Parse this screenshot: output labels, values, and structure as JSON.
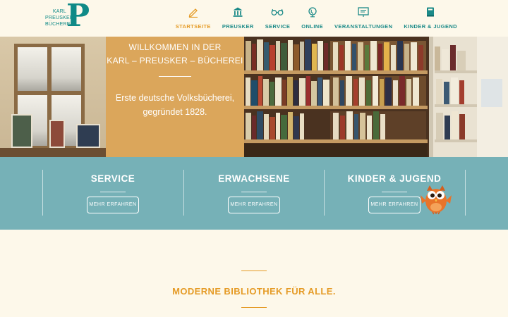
{
  "logo": {
    "line1": "KARL",
    "line2": "PREUSKER",
    "line3": "BÜCHEREI",
    "letter": "P"
  },
  "nav": {
    "items": [
      {
        "label": "STARTSEITE",
        "icon": "pencil-icon"
      },
      {
        "label": "PREUSKER",
        "icon": "building-icon"
      },
      {
        "label": "SERVICE",
        "icon": "glasses-icon"
      },
      {
        "label": "ONLINE",
        "icon": "globe-icon"
      },
      {
        "label": "VERANSTALTUNGEN",
        "icon": "presentation-icon"
      },
      {
        "label": "KINDER & JUGEND",
        "icon": "book-icon"
      }
    ]
  },
  "hero": {
    "title_line1": "WILLKOMMEN IN DER",
    "title_line2": "KARL – PREUSKER – BÜCHEREI",
    "text_line1": "Erste deutsche Volksbücherei,",
    "text_line2": "gegründet 1828."
  },
  "band": {
    "columns": [
      {
        "title": "SERVICE",
        "button": "MEHR ERFAHREN"
      },
      {
        "title": "ERWACHSENE",
        "button": "MEHR ERFAHREN"
      },
      {
        "title": "KINDER & JUGEND",
        "button": "MEHR ERFAHREN"
      }
    ]
  },
  "bottom": {
    "title": "MODERNE BIBLIOTHEK FÜR ALLE."
  },
  "colors": {
    "teal": "#0f8a87",
    "orange": "#e59b26",
    "band": "#76b1b7",
    "cream": "#fdf8ea"
  }
}
